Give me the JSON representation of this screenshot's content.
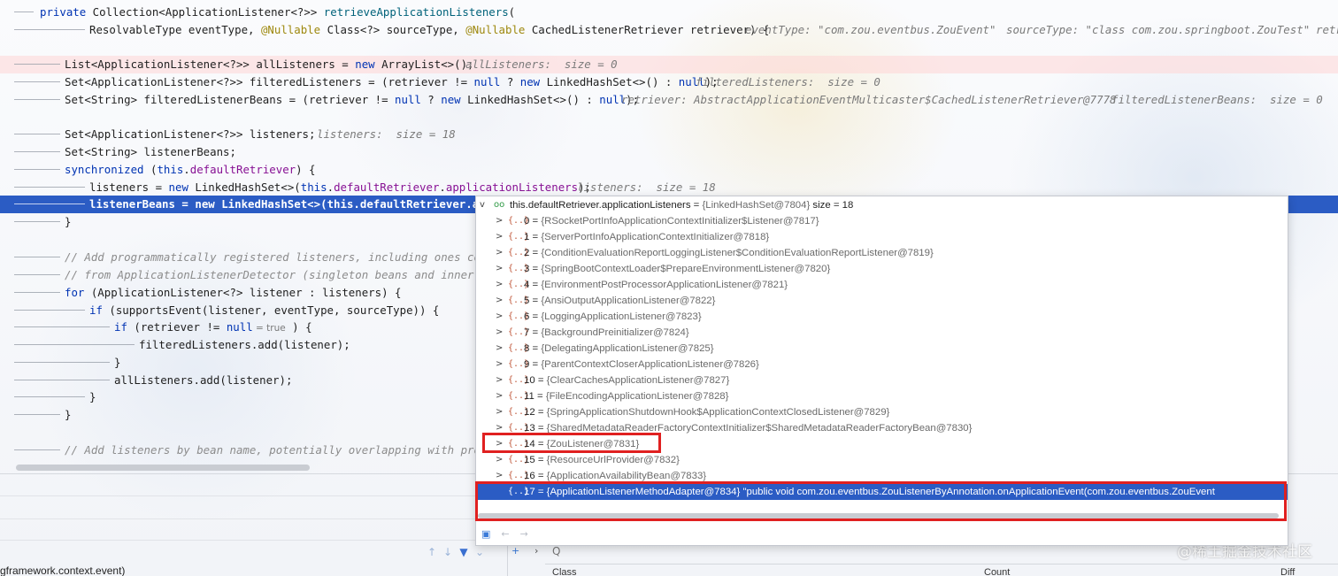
{
  "code": {
    "line1": {
      "kw": "private",
      "rest": " Collection<ApplicationListener<?>> ",
      "method": "retrieveApplicationListeners",
      "paren": "("
    },
    "line2": {
      "a": "ResolvableType eventType, ",
      "ann1": "@Nullable",
      "b": " Class<?> sourceType, ",
      "ann2": "@Nullable",
      "c": " CachedListenerRetriever retriever) {",
      "hint1": "eventType: \"com.zou.eventbus.ZouEvent\"",
      "hint2": "sourceType: \"class com.zou.springboot.ZouTest\"",
      "hint3": "retr"
    },
    "line3": {
      "a": "List<ApplicationListener<?>> allListeners = ",
      "kw": "new",
      "b": " ArrayList<>();",
      "hint": "allListeners:  size = 0"
    },
    "line4": {
      "a": "Set<ApplicationListener<?>> filteredListeners = (retriever != ",
      "kw1": "null",
      "b": " ? ",
      "kw2": "new",
      "c": " LinkedHashSet<>() : ",
      "kw3": "null",
      "d": ");",
      "hint": "filteredListeners:  size = 0"
    },
    "line5": {
      "a": "Set<String> filteredListenerBeans = (retriever != ",
      "kw1": "null",
      "b": " ? ",
      "kw2": "new",
      "c": " LinkedHashSet<>() : ",
      "kw3": "null",
      "d": ");",
      "hint1": "retriever: AbstractApplicationEventMulticaster$CachedListenerRetriever@7778",
      "hint2": "filteredListenerBeans:  size = 0"
    },
    "line6": {
      "a": "Set<ApplicationListener<?>> listeners;",
      "hint": "listeners:  size = 18"
    },
    "line7": {
      "a": "Set<String> listenerBeans;"
    },
    "line8": {
      "kw1": "synchronized",
      "a": " (",
      "kw2": "this",
      "b": ".",
      "fld": "defaultRetriever",
      "c": ") {"
    },
    "line9": {
      "a": "listeners = ",
      "kw1": "new",
      "b": " LinkedHashSet<>(",
      "kw2": "this",
      "c": ".",
      "fld1": "defaultRetriever",
      "d": ".",
      "fld2": "applicationListeners",
      "e": ");",
      "hint": "listeners:  size = 18"
    },
    "line10": {
      "a": "listenerBeans = ",
      "kw1": "new",
      "b": " LinkedHashSet<>(",
      "kw2": "this",
      "c": ".",
      "fld1": "defaultRetriever",
      "d": ".appli"
    },
    "line11": {
      "a": "}"
    },
    "line12": {
      "cmt": "// Add programmatically registered listeners, including ones comin"
    },
    "line13": {
      "cmt": "// from ApplicationListenerDetector (singleton beans and inner bea"
    },
    "line14": {
      "kw": "for",
      "a": " (ApplicationListener<?> listener : listeners) {"
    },
    "line15": {
      "kw": "if",
      "a": " (supportsEvent(listener, eventType, sourceType)) {"
    },
    "line16": {
      "kw1": "if",
      "a": " (retriever != ",
      "kw2": "null",
      "inlay": " = true",
      "b": " ) {"
    },
    "line17": {
      "a": "filteredListeners.add(listener);"
    },
    "line18": {
      "a": "}"
    },
    "line19": {
      "a": "allListeners.add(listener);"
    },
    "line20": {
      "a": "}"
    },
    "line21": {
      "a": "}"
    },
    "line22": {
      "cmt": "// Add listeners by bean name, potentially overlapping with progra"
    }
  },
  "popup": {
    "root": {
      "name": "this.defaultRetriever.applicationListeners",
      "eq": " = ",
      "val": "{LinkedHashSet@7804}",
      "size": "  size = 18"
    },
    "items": [
      {
        "idx": "0",
        "val": "{RSocketPortInfoApplicationContextInitializer$Listener@7817}"
      },
      {
        "idx": "1",
        "val": "{ServerPortInfoApplicationContextInitializer@7818}"
      },
      {
        "idx": "2",
        "val": "{ConditionEvaluationReportLoggingListener$ConditionEvaluationReportListener@7819}"
      },
      {
        "idx": "3",
        "val": "{SpringBootContextLoader$PrepareEnvironmentListener@7820}"
      },
      {
        "idx": "4",
        "val": "{EnvironmentPostProcessorApplicationListener@7821}"
      },
      {
        "idx": "5",
        "val": "{AnsiOutputApplicationListener@7822}"
      },
      {
        "idx": "6",
        "val": "{LoggingApplicationListener@7823}"
      },
      {
        "idx": "7",
        "val": "{BackgroundPreinitializer@7824}"
      },
      {
        "idx": "8",
        "val": "{DelegatingApplicationListener@7825}"
      },
      {
        "idx": "9",
        "val": "{ParentContextCloserApplicationListener@7826}"
      },
      {
        "idx": "10",
        "val": "{ClearCachesApplicationListener@7827}"
      },
      {
        "idx": "11",
        "val": "{FileEncodingApplicationListener@7828}"
      },
      {
        "idx": "12",
        "val": "{SpringApplicationShutdownHook$ApplicationContextClosedListener@7829}"
      },
      {
        "idx": "13",
        "val": "{SharedMetadataReaderFactoryContextInitializer$SharedMetadataReaderFactoryBean@7830}"
      },
      {
        "idx": "14",
        "val": "{ZouListener@7831}"
      },
      {
        "idx": "15",
        "val": "{ResourceUrlProvider@7832}"
      },
      {
        "idx": "16",
        "val": "{ApplicationAvailabilityBean@7833}"
      },
      {
        "idx": "17",
        "val": "{ApplicationListenerMethodAdapter@7834} \"public void com.zou.eventbus.ZouListenerByAnnotation.onApplicationEvent(com.zou.eventbus.ZouEvent"
      }
    ],
    "field_icon": "{..}",
    "chevron": ">",
    "root_chevron": "v",
    "eyes_icon": "oo",
    "nav": {
      "folder": "▣",
      "back": "←",
      "forward": "→"
    }
  },
  "bottom": {
    "frames_text": "gframework.context.event)",
    "search_icon": "Q",
    "columns": {
      "class": "Class",
      "count": "Count",
      "diff": "Diff"
    },
    "watermark": "@稀土掘金技术社区"
  },
  "colors": {
    "selection": "#2b5cc4",
    "highlight_box": "#e02020",
    "keyword": "#0033b3",
    "field": "#871094",
    "annotation": "#9e880d"
  }
}
